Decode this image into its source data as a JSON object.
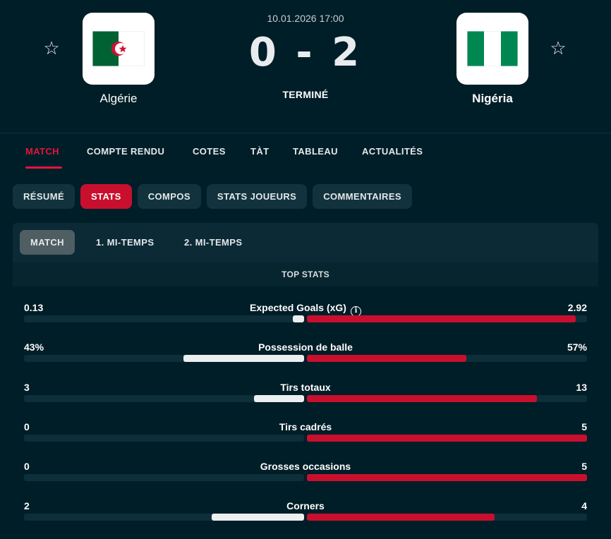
{
  "match": {
    "datetime": "10.01.2026 17:00",
    "score": "0 - 2",
    "status": "TERMINÉ",
    "home": {
      "name": "Algérie",
      "flag_colors": [
        "#006233",
        "#ffffff",
        "#d21034"
      ]
    },
    "away": {
      "name": "Nigéria",
      "flag_colors": [
        "#008751",
        "#ffffff",
        "#008751"
      ]
    }
  },
  "main_tabs": [
    "MATCH",
    "COMPTE RENDU",
    "COTES",
    "TÀT",
    "TABLEAU",
    "ACTUALITÉS"
  ],
  "sub_tabs": [
    "RÉSUMÉ",
    "STATS",
    "COMPOS",
    "STATS JOUEURS",
    "COMMENTAIRES"
  ],
  "periods": [
    "MATCH",
    "1. MI-TEMPS",
    "2. MI-TEMPS"
  ],
  "section_title": "TOP STATS",
  "stats": [
    {
      "label": "Expected Goals (xG)",
      "home": "0.13",
      "away": "2.92",
      "home_share": 0.04,
      "away_share": 0.96,
      "info": "i"
    },
    {
      "label": "Possession de balle",
      "home": "43%",
      "away": "57%",
      "home_share": 0.43,
      "away_share": 0.57
    },
    {
      "label": "Tirs totaux",
      "home": "3",
      "away": "13",
      "home_share": 0.18,
      "away_share": 0.82
    },
    {
      "label": "Tirs cadrés",
      "home": "0",
      "away": "5",
      "home_share": 0,
      "away_share": 1
    },
    {
      "label": "Grosses occasions",
      "home": "0",
      "away": "5",
      "home_share": 0,
      "away_share": 1
    },
    {
      "label": "Corners",
      "home": "2",
      "away": "4",
      "home_share": 0.33,
      "away_share": 0.67
    }
  ],
  "colors": {
    "accent": "#c8102e",
    "background": "#001e28"
  },
  "icons": {
    "favorite": "star-outline-icon",
    "info": "info-icon"
  }
}
